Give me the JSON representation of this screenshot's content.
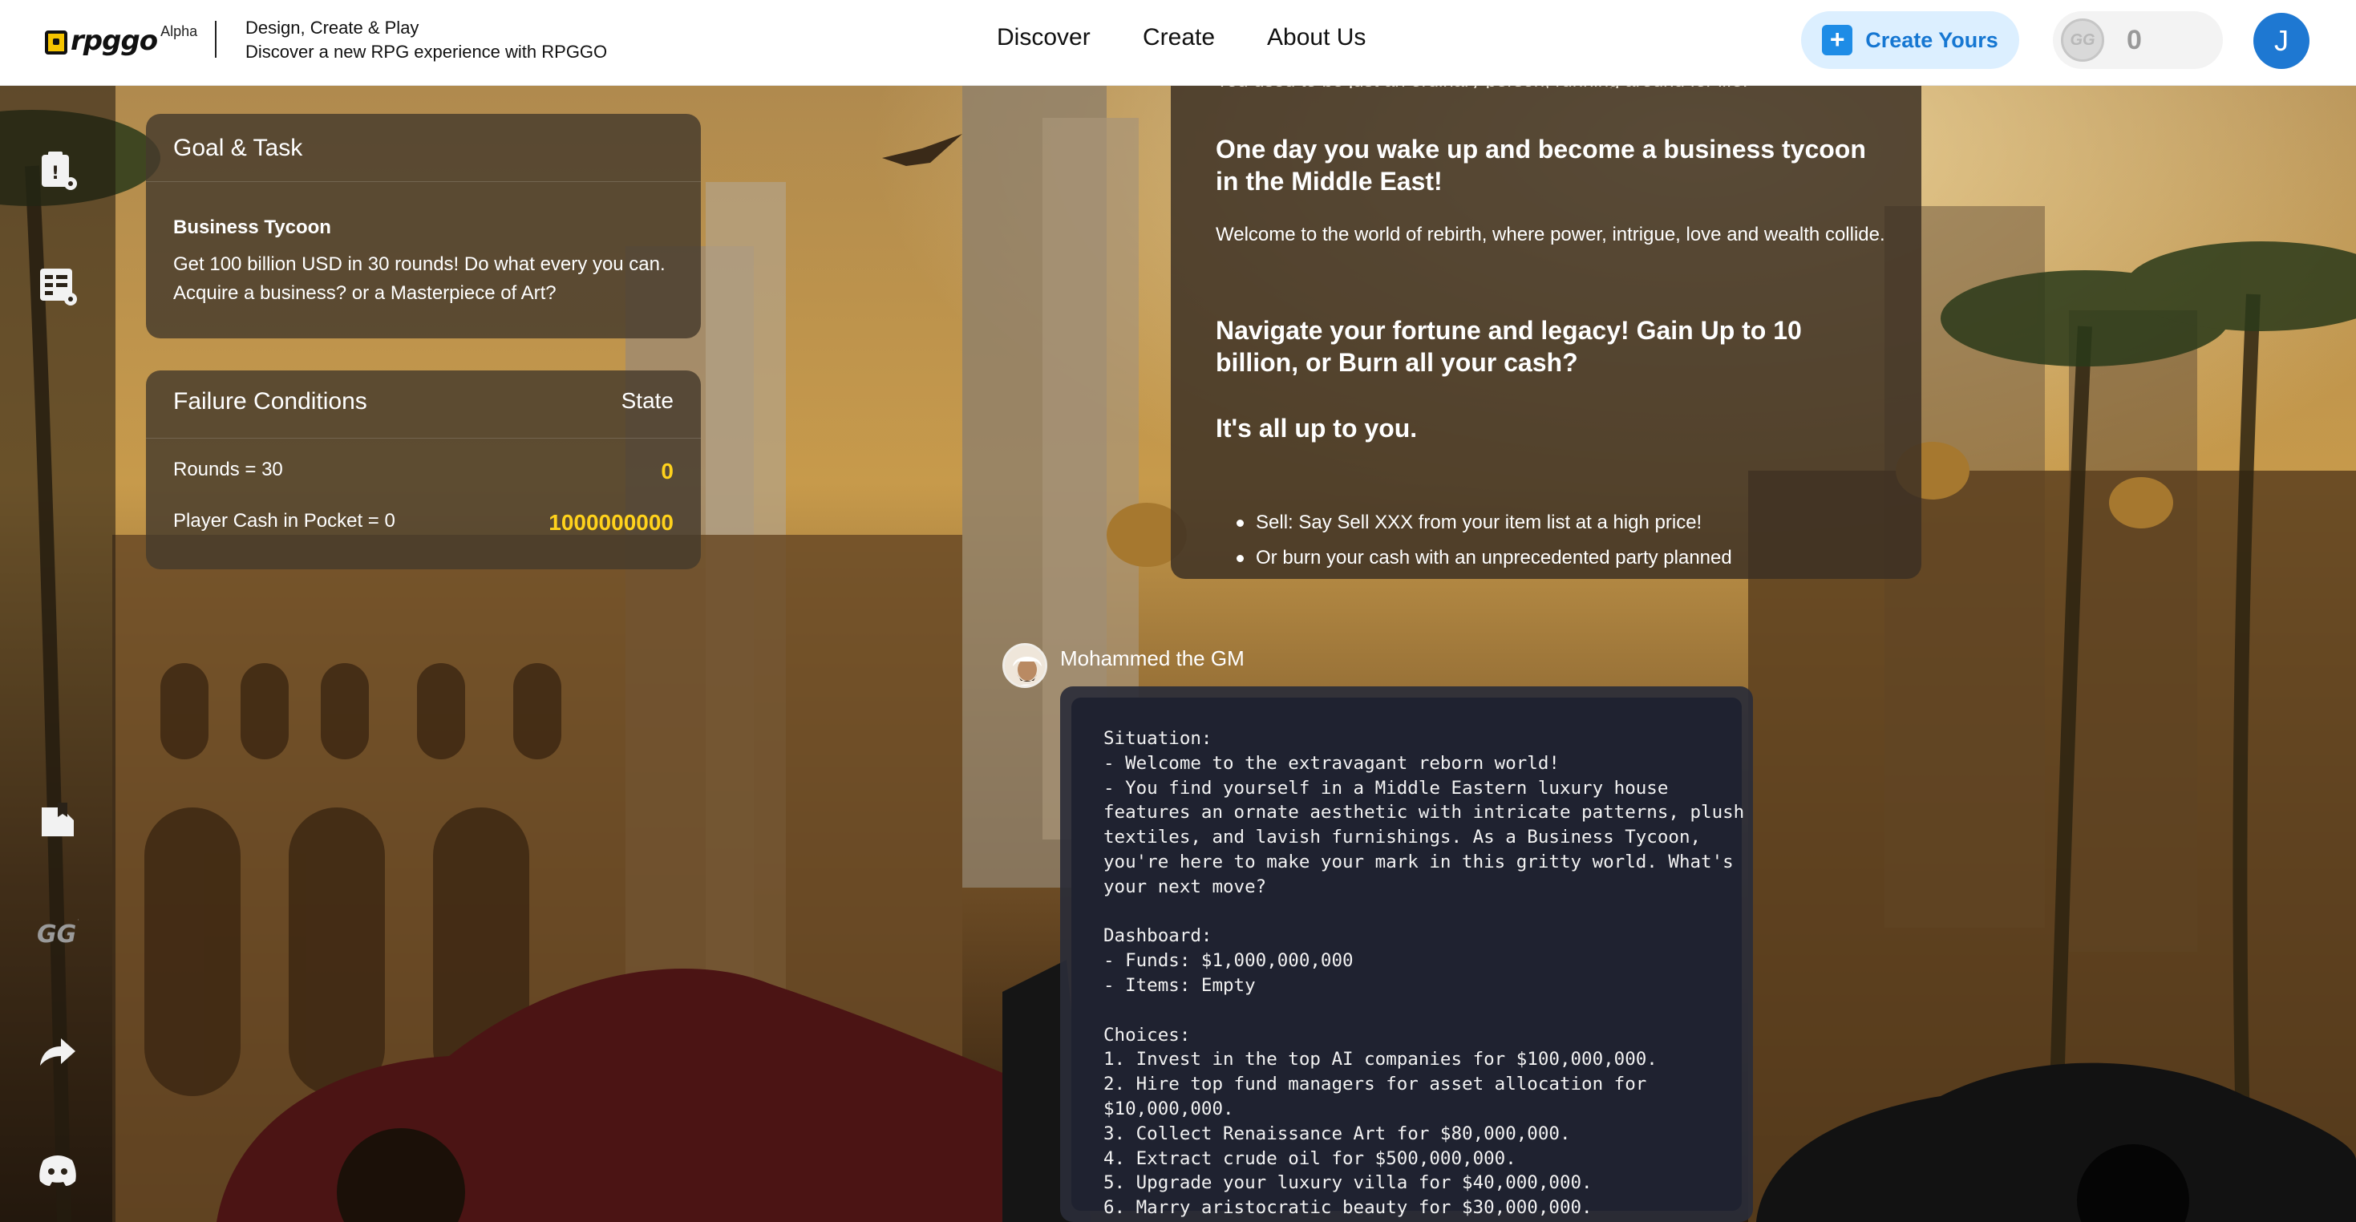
{
  "header": {
    "logo_text": "rpggo",
    "logo_badge": "Alpha",
    "tagline_line1": "Design, Create & Play",
    "tagline_line2": "Discover a new RPG experience with RPGGO",
    "nav": [
      "Discover",
      "Create",
      "About Us"
    ],
    "create_button": "Create Yours",
    "coin_icon_label": "GG",
    "coin_count": "0",
    "avatar_initial": "J"
  },
  "sidebar": {
    "icons": [
      "clipboard-task-icon",
      "list-settings-icon",
      "tag-icon",
      "gg-coin-icon",
      "share-arrow-icon",
      "discord-icon"
    ]
  },
  "goal_card": {
    "title": "Goal & Task",
    "subtitle": "Business Tycoon",
    "description": "Get 100 billion USD in 30 rounds! Do what every you can. Acquire a business? or a Masterpiece of Art?"
  },
  "failure_card": {
    "title": "Failure Conditions",
    "state_header": "State",
    "rows": [
      {
        "label": "Rounds = 30",
        "value": "0"
      },
      {
        "label": "Player Cash in Pocket = 0",
        "value": "1000000000"
      }
    ]
  },
  "intro_card": {
    "cut_line": "You used to be just an ordinary person, running around for life.",
    "heading1": "One day you wake up and become a business tycoon in the Middle East!",
    "para1": "Welcome to the world of rebirth, where power, intrigue, love and wealth collide.",
    "heading2": "Navigate your fortune and legacy! Gain Up to 10 billion, or Burn all your cash?",
    "heading3": "It's all up to you.",
    "bullets": [
      "Sell: Say Sell XXX from your item list at a high price!",
      "Or burn your cash with an unprecedented party planned"
    ]
  },
  "gm_message": {
    "name": "Mohammed the GM",
    "text": "Situation:\n- Welcome to the extravagant reborn world!\n- You find yourself in a Middle Eastern luxury house features an ornate aesthetic with intricate patterns, plush textiles, and lavish furnishings. As a Business Tycoon, you're here to make your mark in this gritty world. What's your next move?\n\nDashboard:\n- Funds: $1,000,000,000\n- Items: Empty\n\nChoices:\n1. Invest in the top AI companies for $100,000,000.\n2. Hire top fund managers for asset allocation for $10,000,000.\n3. Collect Renaissance Art for $80,000,000.\n4. Extract crude oil for $500,000,000.\n5. Upgrade your luxury villa for $40,000,000.\n6. Marry aristocratic beauty for $30,000,000."
  }
}
